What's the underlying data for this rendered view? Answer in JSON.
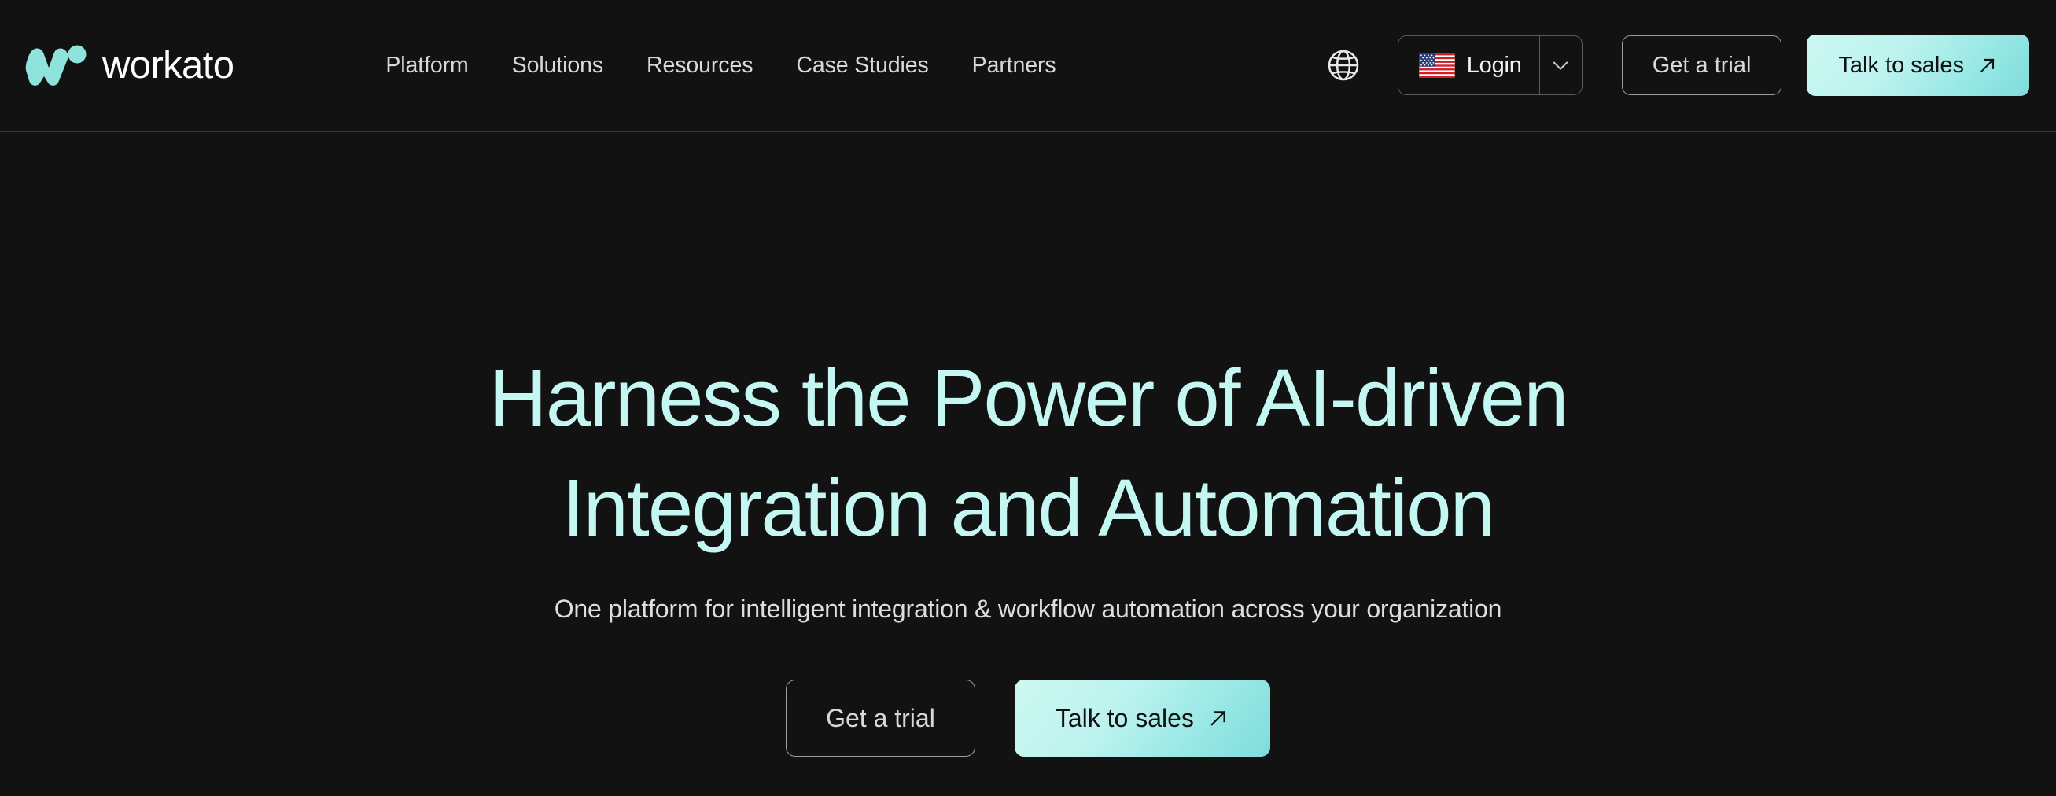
{
  "brand": {
    "name": "workato",
    "logo_icon": "workato-w-logomark",
    "logo_color": "#8EE3DA"
  },
  "nav": {
    "items": [
      {
        "label": "Platform"
      },
      {
        "label": "Solutions"
      },
      {
        "label": "Resources"
      },
      {
        "label": "Case Studies"
      },
      {
        "label": "Partners"
      }
    ]
  },
  "header": {
    "language_icon": "globe-icon",
    "login": {
      "label": "Login",
      "flag_icon": "us-flag-icon",
      "caret_icon": "chevron-down-icon"
    },
    "trial_button": {
      "label": "Get a trial"
    },
    "sales_button": {
      "label": "Talk to sales",
      "arrow_icon": "arrow-up-right-icon"
    }
  },
  "hero": {
    "title_line_1": "Harness the Power of AI-driven",
    "title_line_2": "Integration and Automation",
    "subtitle": "One platform for intelligent integration & workflow automation across your organization",
    "trial_button": {
      "label": "Get a trial"
    },
    "sales_button": {
      "label": "Talk to sales",
      "arrow_icon": "arrow-up-right-icon"
    }
  },
  "theme": {
    "background": "#121212",
    "accent_mint": "#8EE3DA",
    "headline_color": "#C4F7F2",
    "gradient_start": "#CDF8F1",
    "gradient_end": "#7FDDDB",
    "nav_text": "#D9D9D9",
    "divider": "#3A3A3A"
  }
}
